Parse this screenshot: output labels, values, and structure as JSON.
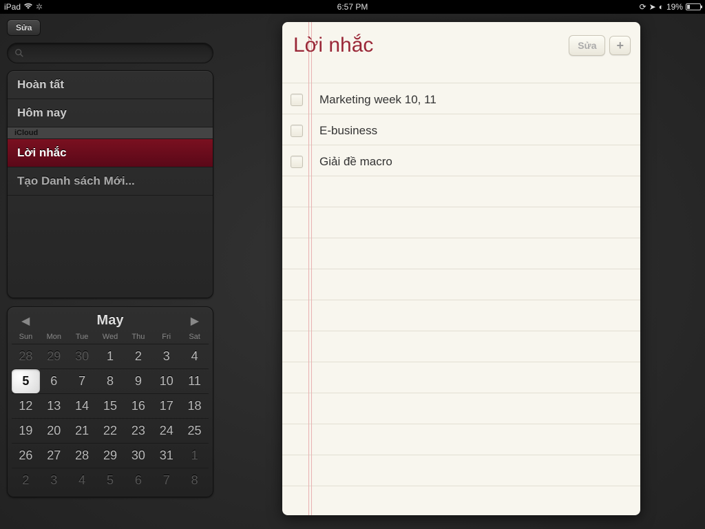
{
  "status": {
    "device": "iPad",
    "time": "6:57 PM",
    "battery": "19%"
  },
  "sidebar": {
    "edit": "Sửa",
    "search_placeholder": "",
    "completed": "Hoàn tất",
    "today": "Hôm nay",
    "section": "iCloud",
    "reminders": "Lời nhắc",
    "create_new": "Tạo Danh sách Mới..."
  },
  "calendar": {
    "month": "May",
    "dow": [
      "Sun",
      "Mon",
      "Tue",
      "Wed",
      "Thu",
      "Fri",
      "Sat"
    ],
    "days": [
      {
        "n": "28",
        "dim": true
      },
      {
        "n": "29",
        "dim": true
      },
      {
        "n": "30",
        "dim": true
      },
      {
        "n": "1"
      },
      {
        "n": "2"
      },
      {
        "n": "3"
      },
      {
        "n": "4"
      },
      {
        "n": "5",
        "today": true
      },
      {
        "n": "6"
      },
      {
        "n": "7"
      },
      {
        "n": "8"
      },
      {
        "n": "9"
      },
      {
        "n": "10"
      },
      {
        "n": "11"
      },
      {
        "n": "12"
      },
      {
        "n": "13"
      },
      {
        "n": "14"
      },
      {
        "n": "15"
      },
      {
        "n": "16"
      },
      {
        "n": "17"
      },
      {
        "n": "18"
      },
      {
        "n": "19"
      },
      {
        "n": "20"
      },
      {
        "n": "21"
      },
      {
        "n": "22"
      },
      {
        "n": "23"
      },
      {
        "n": "24"
      },
      {
        "n": "25"
      },
      {
        "n": "26"
      },
      {
        "n": "27"
      },
      {
        "n": "28"
      },
      {
        "n": "29"
      },
      {
        "n": "30"
      },
      {
        "n": "31"
      },
      {
        "n": "1",
        "dim": true
      },
      {
        "n": "2",
        "dim": true
      },
      {
        "n": "3",
        "dim": true
      },
      {
        "n": "4",
        "dim": true
      },
      {
        "n": "5",
        "dim": true
      },
      {
        "n": "6",
        "dim": true
      },
      {
        "n": "7",
        "dim": true
      },
      {
        "n": "8",
        "dim": true
      }
    ]
  },
  "note": {
    "title": "Lời nhắc",
    "edit": "Sửa",
    "items": [
      "Marketing week 10, 11",
      "E-business",
      "Giải đề macro"
    ]
  }
}
